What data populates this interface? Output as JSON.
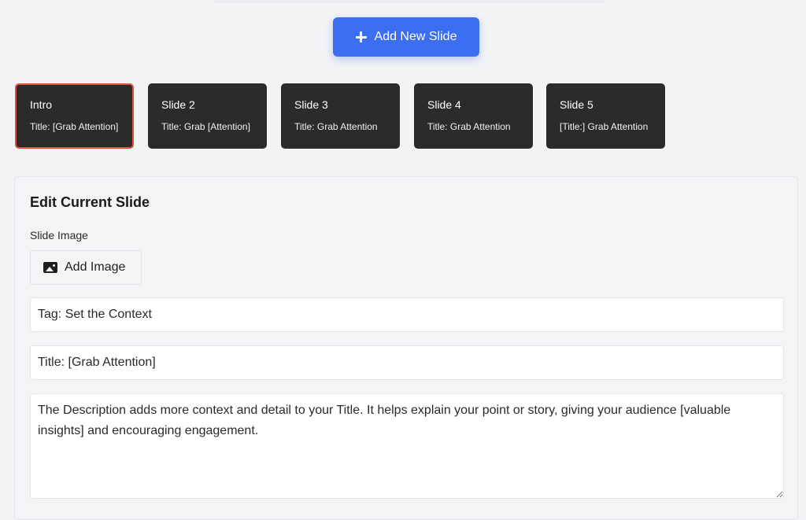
{
  "toolbar": {
    "add_slide_label": "Add New Slide",
    "add_slide_icon": "plus-icon",
    "accent_color": "#3b6ef0"
  },
  "slides": [
    {
      "name": "Intro",
      "subtitle": "Title: [Grab Attention]",
      "active": true
    },
    {
      "name": "Slide 2",
      "subtitle": "Title: Grab [Attention]",
      "active": false
    },
    {
      "name": "Slide 3",
      "subtitle": "Title: Grab Attention",
      "active": false
    },
    {
      "name": "Slide 4",
      "subtitle": "Title: Grab Attention",
      "active": false
    },
    {
      "name": "Slide 5",
      "subtitle": "[Title:] Grab Attention",
      "active": false
    }
  ],
  "active_slide_border_color": "#e0503a",
  "editor": {
    "heading": "Edit Current Slide",
    "image_label": "Slide Image",
    "add_image_label": "Add Image",
    "add_image_icon": "image-icon",
    "tag_value": "Tag: Set the Context",
    "title_value": "Title: [Grab Attention]",
    "description_value": "The Description adds more context and detail to your Title. It helps explain your point or story, giving your audience [valuable insights] and encouraging engagement."
  }
}
